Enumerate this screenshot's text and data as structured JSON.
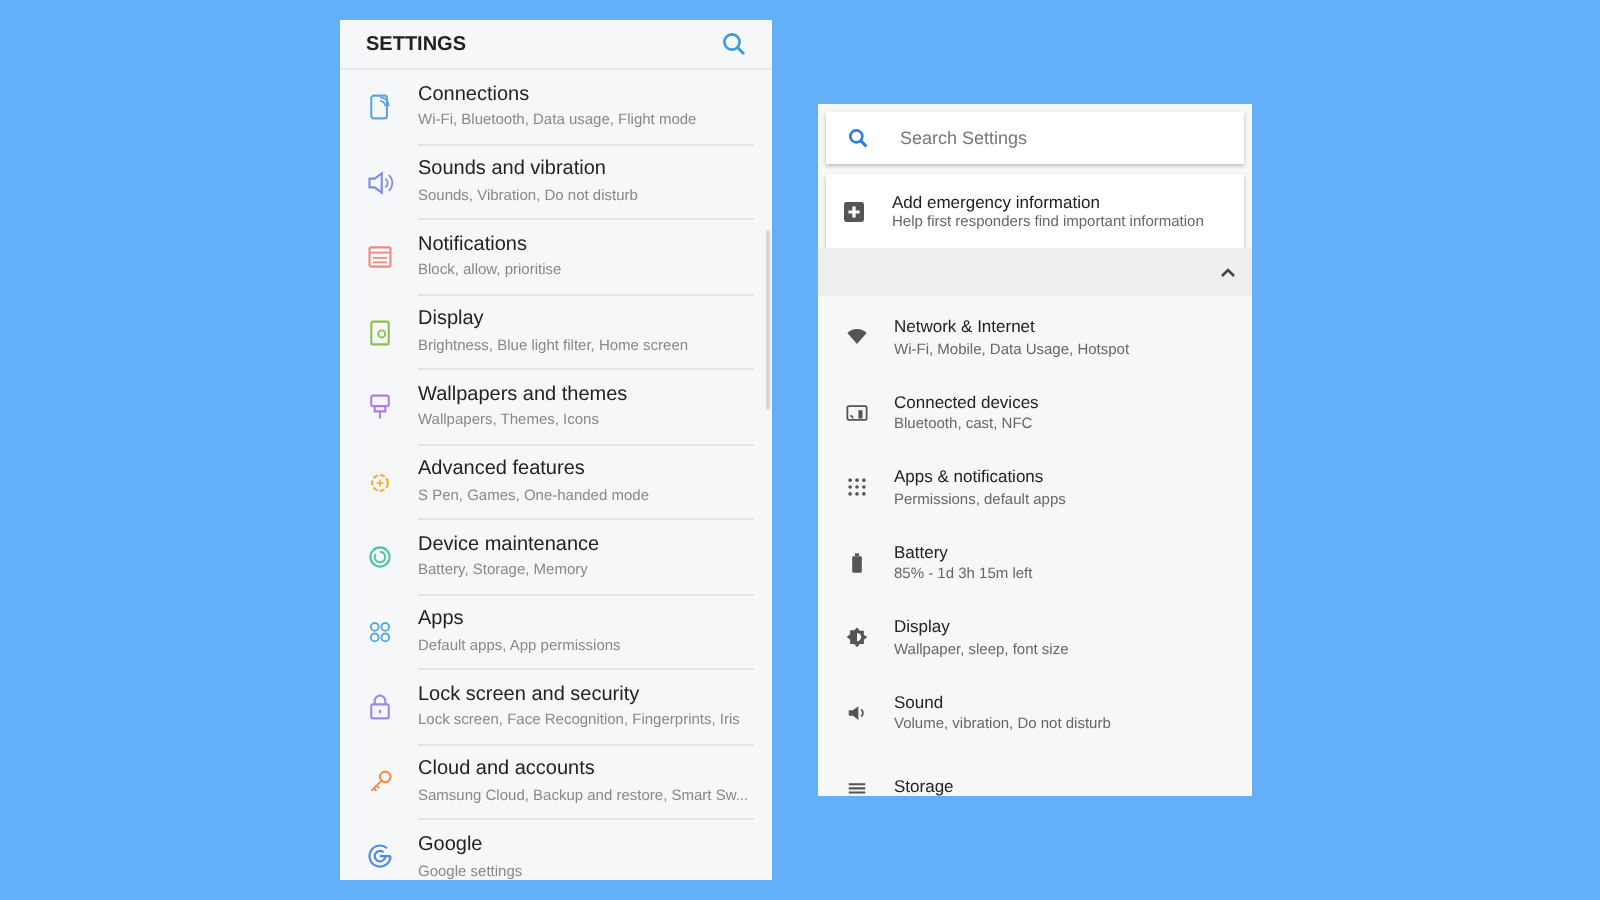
{
  "samsung_settings": {
    "title": "SETTINGS",
    "items": [
      {
        "title": "Connections",
        "subtitle": "Wi-Fi, Bluetooth, Data usage, Flight mode"
      },
      {
        "title": "Sounds and vibration",
        "subtitle": "Sounds, Vibration, Do not disturb"
      },
      {
        "title": "Notifications",
        "subtitle": "Block, allow, prioritise"
      },
      {
        "title": "Display",
        "subtitle": "Brightness, Blue light filter, Home screen"
      },
      {
        "title": "Wallpapers and themes",
        "subtitle": "Wallpapers, Themes, Icons"
      },
      {
        "title": "Advanced features",
        "subtitle": "S Pen, Games, One-handed mode"
      },
      {
        "title": "Device maintenance",
        "subtitle": "Battery, Storage, Memory"
      },
      {
        "title": "Apps",
        "subtitle": "Default apps, App permissions"
      },
      {
        "title": "Lock screen and security",
        "subtitle": "Lock screen, Face Recognition, Fingerprints, Iris"
      },
      {
        "title": "Cloud and accounts",
        "subtitle": "Samsung Cloud, Backup and restore, Smart Sw..."
      },
      {
        "title": "Google",
        "subtitle": "Google settings"
      }
    ]
  },
  "android_settings": {
    "search": {
      "placeholder": "Search Settings"
    },
    "suggestion": {
      "title": "Add emergency information",
      "subtitle": "Help first responders find important information"
    },
    "suggestions_expanded": true,
    "items": [
      {
        "title": "Network & Internet",
        "subtitle": "Wi-Fi, Mobile, Data Usage, Hotspot"
      },
      {
        "title": "Connected devices",
        "subtitle": "Bluetooth, cast, NFC"
      },
      {
        "title": "Apps & notifications",
        "subtitle": "Permissions, default apps"
      },
      {
        "title": "Battery",
        "subtitle": "85% - 1d 3h 15m left"
      },
      {
        "title": "Display",
        "subtitle": "Wallpaper, sleep, font size"
      },
      {
        "title": "Sound",
        "subtitle": "Volume, vibration, Do not disturb"
      },
      {
        "title": "Storage"
      }
    ]
  }
}
